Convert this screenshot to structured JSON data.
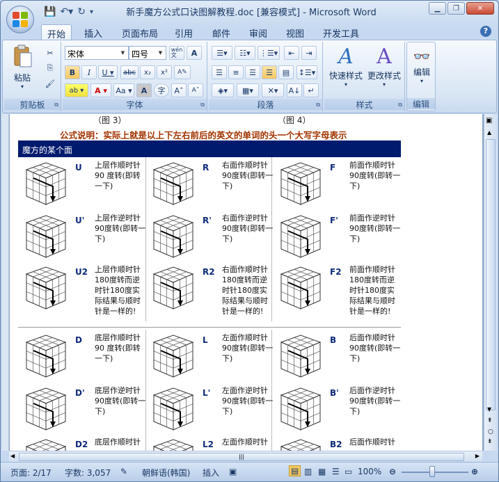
{
  "window": {
    "title": "新手魔方公式口诀图解教程.doc [兼容模式] - Microsoft Word"
  },
  "tabs": [
    "开始",
    "插入",
    "页面布局",
    "引用",
    "邮件",
    "审阅",
    "视图",
    "开发工具"
  ],
  "ribbon": {
    "clipboard": {
      "label": "剪贴板",
      "paste": "粘贴"
    },
    "font": {
      "label": "字体",
      "font_name": "宋体",
      "font_size": "四号",
      "wen": "wén\n文"
    },
    "paragraph": {
      "label": "段落"
    },
    "styles": {
      "label": "样式",
      "quick": "快速样式",
      "change": "更改样式"
    },
    "editing": {
      "label": "编辑",
      "edit": "编辑"
    }
  },
  "document": {
    "captions": [
      "（图 3）",
      "（图 4）"
    ],
    "formula_note": "公式说明：实际上就是以上下左右前后的英文的单词的头一个大写字母表示",
    "table_header": "魔方的某个面",
    "moves": [
      {
        "code": "U",
        "desc": "上层作顺时针90 度转(即转一下)"
      },
      {
        "code": "R",
        "desc": "右面作顺时针90度转(即转一下)"
      },
      {
        "code": "F",
        "desc": "前面作顺时针90度转(即转一下)"
      },
      {
        "code": "U'",
        "desc": "上层作逆时针90度转(即转一下)"
      },
      {
        "code": "R'",
        "desc": "右面作逆时针90度转(即转一下)"
      },
      {
        "code": "F'",
        "desc": "前面作逆时针90度转(即转一下)"
      },
      {
        "code": "U2",
        "desc": "上层作顺时针180度转而逆时针180度实际结果与顺时针是一样的!"
      },
      {
        "code": "R2",
        "desc": "右面作顺时针180度转而逆时针180度实际结果与顺时针是一样的!"
      },
      {
        "code": "F2",
        "desc": "前面作顺时针180度转而逆时针180度实际结果与顺时针是一样的!"
      },
      {
        "code": "D",
        "desc": "底层作顺时针90 度转(即转一下)"
      },
      {
        "code": "L",
        "desc": "左面作顺时针90度转(即转一下)"
      },
      {
        "code": "B",
        "desc": "后面作顺时针90度转(即转一下)"
      },
      {
        "code": "D'",
        "desc": "底层作逆时针90度转(即转一下)"
      },
      {
        "code": "L'",
        "desc": "左面作逆时针90度转(即转一下)"
      },
      {
        "code": "B'",
        "desc": "后面作逆时针90度转(即转一下)"
      },
      {
        "code": "D2",
        "desc": "底层作顺时针"
      },
      {
        "code": "L2",
        "desc": "左面作顺时针"
      },
      {
        "code": "B2",
        "desc": "后面作顺时针"
      }
    ]
  },
  "status": {
    "page": "页面: 2/17",
    "words": "字数: 3,057",
    "lang": "朝鲜语(韩国)",
    "mode": "插入",
    "zoom": "100%"
  }
}
